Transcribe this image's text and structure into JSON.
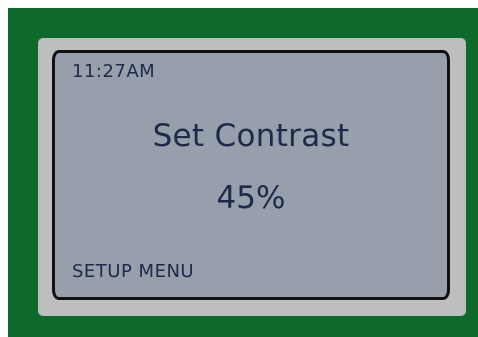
{
  "display": {
    "time": "11:27AM",
    "title": "Set Contrast",
    "contrast_value": "45%",
    "contrast_level": 0.45,
    "menu_label": "SETUP MENU"
  },
  "colors": {
    "device_body": "#0e6a2c",
    "bezel": "#bcbfbd",
    "lcd_background": "#969fab",
    "lcd_text": "#1f2a4a",
    "screen_border": "#101010"
  }
}
